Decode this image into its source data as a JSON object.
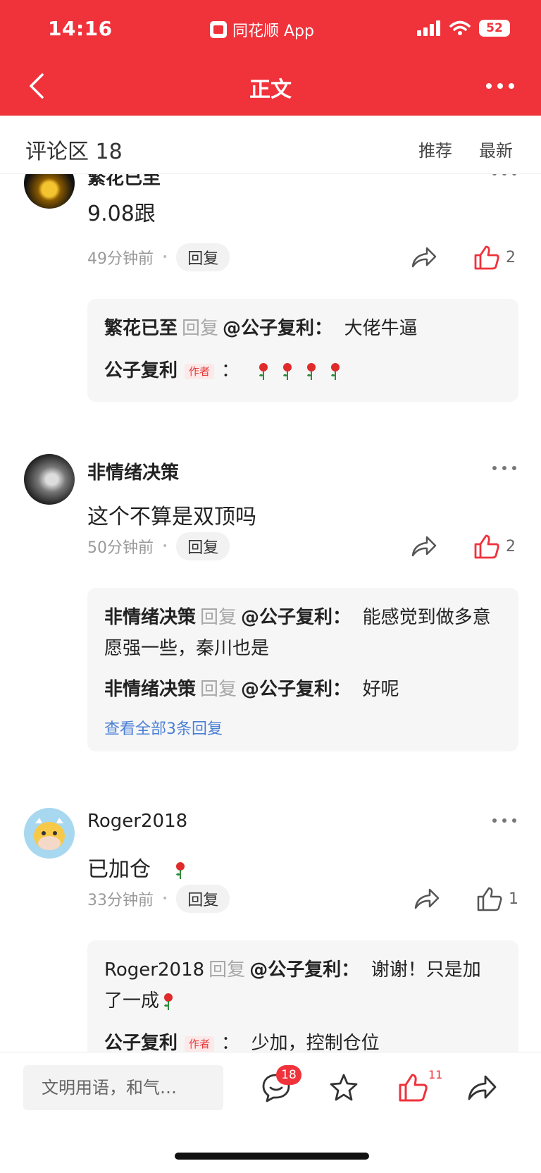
{
  "status_bar": {
    "time": "14:16",
    "app_label": "同花顺 App",
    "battery": "52"
  },
  "nav": {
    "title": "正文"
  },
  "section": {
    "title": "评论区 18",
    "sort_recommend": "推荐",
    "sort_latest": "最新"
  },
  "comments": [
    {
      "username": "繁花已至",
      "text": "9.08跟",
      "time": "49分钟前",
      "reply_label": "回复",
      "likes": "2",
      "liked": true,
      "replies": [
        {
          "name": "繁花已至",
          "verb": "回复",
          "target": "@公子复利：",
          "text": "大佬牛逼"
        },
        {
          "name": "公子复利",
          "tag": "作者",
          "text": "：",
          "emoji": "🌹🌹🌹🌹"
        }
      ]
    },
    {
      "username": "非情绪决策",
      "text": "这个不算是双顶吗",
      "time": "50分钟前",
      "reply_label": "回复",
      "likes": "2",
      "liked": true,
      "replies": [
        {
          "name": "非情绪决策",
          "verb": "回复",
          "target": "@公子复利：",
          "text": "能感觉到做多意愿强一些，秦川也是"
        },
        {
          "name": "非情绪决策",
          "verb": "回复",
          "target": "@公子复利：",
          "text": "好呢"
        }
      ],
      "view_all": "查看全部3条回复"
    },
    {
      "username": "Roger2018",
      "text": "已加仓",
      "emoji": "🌹",
      "time": "33分钟前",
      "reply_label": "回复",
      "likes": "1",
      "liked": false,
      "replies": [
        {
          "name": "Roger2018",
          "verb": "回复",
          "target": "@公子复利：",
          "text": "谢谢！只是加了一成",
          "emoji": "🌹"
        },
        {
          "name": "公子复利",
          "tag": "作者",
          "text": "：",
          "text2": "少加，控制仓位"
        }
      ]
    }
  ],
  "bottom": {
    "input_placeholder": "文明用语，和气…",
    "comment_badge": "18",
    "like_badge": "11"
  },
  "colors": {
    "brand_red": "#f0323b",
    "link_blue": "#4a7fd6"
  }
}
